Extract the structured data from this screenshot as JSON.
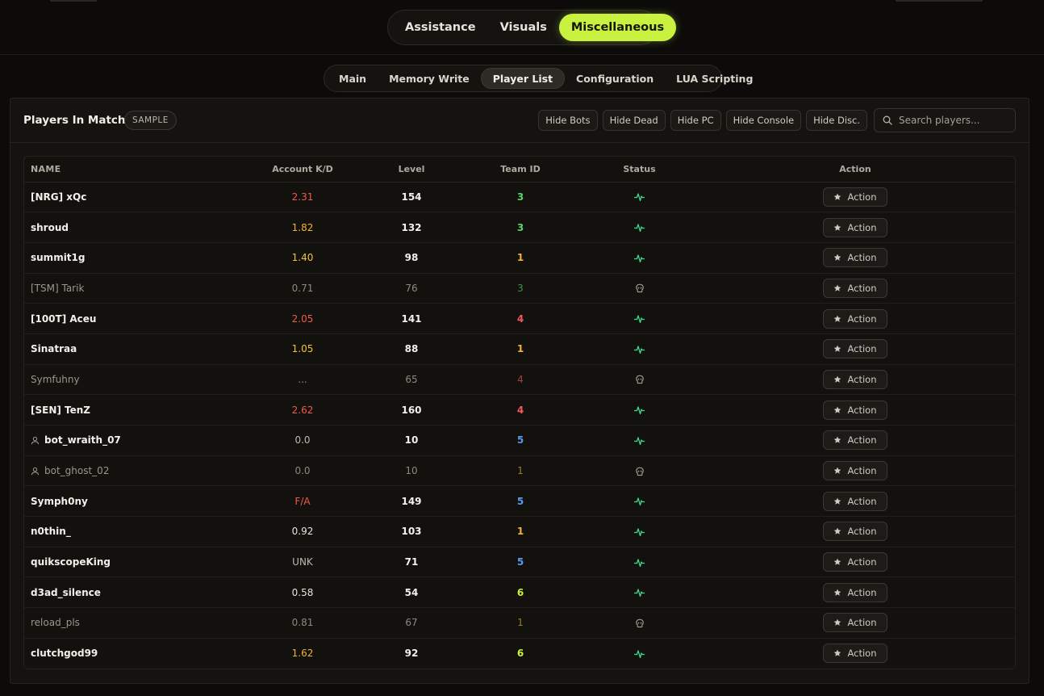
{
  "main_tabs": [
    {
      "label": "Assistance",
      "active": false
    },
    {
      "label": "Visuals",
      "active": false
    },
    {
      "label": "Miscellaneous",
      "active": true
    }
  ],
  "sub_tabs": [
    {
      "label": "Main",
      "active": false
    },
    {
      "label": "Memory Write",
      "active": false
    },
    {
      "label": "Player List",
      "active": true
    },
    {
      "label": "Configuration",
      "active": false
    },
    {
      "label": "LUA Scripting",
      "active": false
    }
  ],
  "panel": {
    "title": "Players In Match",
    "badge": "SAMPLE",
    "filters": [
      "Hide Bots",
      "Hide Dead",
      "Hide PC",
      "Hide Console",
      "Hide Disc."
    ],
    "search_placeholder": "Search players..."
  },
  "table": {
    "columns": [
      "NAME",
      "Account K/D",
      "Level",
      "Team ID",
      "Status",
      "Action"
    ],
    "rows": [
      {
        "name": "[NRG] xQc",
        "kd": "2.31",
        "kd_color": "#ef5b4c",
        "level": "154",
        "team": "3",
        "team_color": "#5bd46a",
        "status": "alive",
        "bot": false,
        "dim": false,
        "action": "Action"
      },
      {
        "name": "shroud",
        "kd": "1.82",
        "kd_color": "#f2b23a",
        "level": "132",
        "team": "3",
        "team_color": "#5bd46a",
        "status": "alive",
        "bot": false,
        "dim": false,
        "action": "Action"
      },
      {
        "name": "summit1g",
        "kd": "1.40",
        "kd_color": "#f2c53a",
        "level": "98",
        "team": "1",
        "team_color": "#f2b23a",
        "status": "alive",
        "bot": false,
        "dim": false,
        "action": "Action"
      },
      {
        "name": "[TSM] Tarik",
        "kd": "0.71",
        "kd_color": "#8d897f",
        "level": "76",
        "team": "3",
        "team_color": "#5bd46a",
        "status": "dead",
        "bot": false,
        "dim": true,
        "action": "Action"
      },
      {
        "name": "[100T] Aceu",
        "kd": "2.05",
        "kd_color": "#ef5b4c",
        "level": "141",
        "team": "4",
        "team_color": "#ef5b5b",
        "status": "alive",
        "bot": false,
        "dim": false,
        "action": "Action"
      },
      {
        "name": "Sinatraa",
        "kd": "1.05",
        "kd_color": "#f2c53a",
        "level": "88",
        "team": "1",
        "team_color": "#f2b23a",
        "status": "alive",
        "bot": false,
        "dim": false,
        "action": "Action"
      },
      {
        "name": "Symfuhny",
        "kd": "...",
        "kd_color": "#8d897f",
        "level": "65",
        "team": "4",
        "team_color": "#ef5b5b",
        "status": "dead",
        "bot": false,
        "dim": true,
        "action": "Action"
      },
      {
        "name": "[SEN] TenZ",
        "kd": "2.62",
        "kd_color": "#ef5b4c",
        "level": "160",
        "team": "4",
        "team_color": "#ef5b5b",
        "status": "alive",
        "bot": false,
        "dim": false,
        "action": "Action"
      },
      {
        "name": "bot_wraith_07",
        "kd": "0.0",
        "kd_color": "#bdb9ae",
        "level": "10",
        "team": "5",
        "team_color": "#5a9bf0",
        "status": "alive",
        "bot": true,
        "dim": false,
        "action": "Action"
      },
      {
        "name": "bot_ghost_02",
        "kd": "0.0",
        "kd_color": "#8d897f",
        "level": "10",
        "team": "1",
        "team_color": "#f2b23a",
        "status": "dead",
        "bot": true,
        "dim": true,
        "action": "Action"
      },
      {
        "name": "Symph0ny",
        "kd": "F/A",
        "kd_color": "#ef5b4c",
        "level": "149",
        "team": "5",
        "team_color": "#5a9bf0",
        "status": "alive",
        "bot": false,
        "dim": false,
        "action": "Action"
      },
      {
        "name": "n0thin_",
        "kd": "0.92",
        "kd_color": "#e6e3da",
        "level": "103",
        "team": "1",
        "team_color": "#f2b23a",
        "status": "alive",
        "bot": false,
        "dim": false,
        "action": "Action"
      },
      {
        "name": "quikscopeKing",
        "kd": "UNK",
        "kd_color": "#bdb9ae",
        "level": "71",
        "team": "5",
        "team_color": "#5a9bf0",
        "status": "alive",
        "bot": false,
        "dim": false,
        "action": "Action"
      },
      {
        "name": "d3ad_silence",
        "kd": "0.58",
        "kd_color": "#e6e3da",
        "level": "54",
        "team": "6",
        "team_color": "#c8f23f",
        "status": "alive",
        "bot": false,
        "dim": false,
        "action": "Action"
      },
      {
        "name": "reload_pls",
        "kd": "0.81",
        "kd_color": "#8d897f",
        "level": "67",
        "team": "1",
        "team_color": "#f2b23a",
        "status": "dead",
        "bot": false,
        "dim": true,
        "action": "Action"
      },
      {
        "name": "clutchgod99",
        "kd": "1.62",
        "kd_color": "#f2b23a",
        "level": "92",
        "team": "6",
        "team_color": "#c8f23f",
        "status": "alive",
        "bot": false,
        "dim": false,
        "action": "Action"
      }
    ]
  },
  "icons": {
    "alive": "pulse-icon",
    "dead": "skull-icon",
    "bot": "user-icon",
    "action": "star-icon",
    "search": "search-icon"
  }
}
